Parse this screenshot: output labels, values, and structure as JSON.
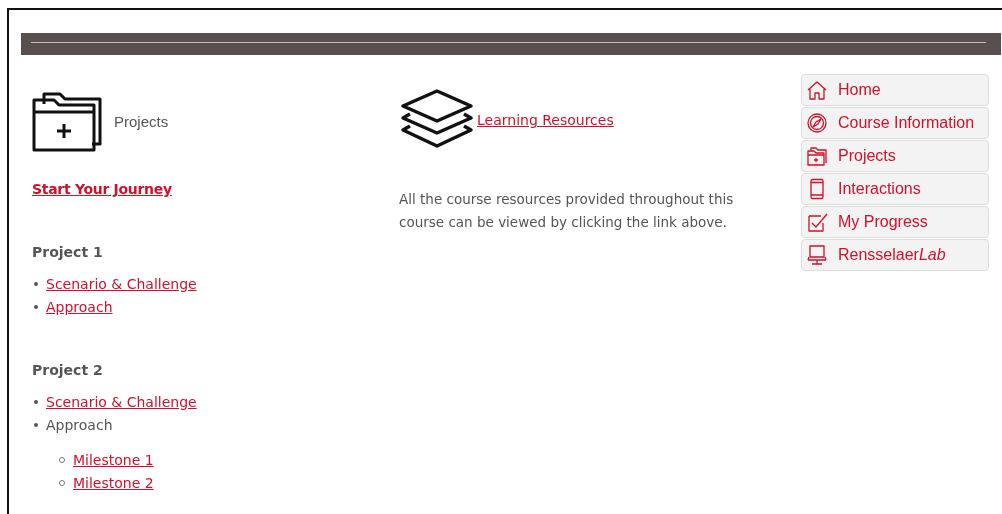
{
  "projects_card": {
    "title": "Projects"
  },
  "start_link": "Start Your Journey",
  "projects": [
    {
      "heading": "Project 1",
      "items": [
        {
          "label": "Scenario & Challenge",
          "kind": "link"
        },
        {
          "label": "Approach",
          "kind": "link"
        }
      ]
    },
    {
      "heading": "Project 2",
      "items": [
        {
          "label": "Scenario & Challenge",
          "kind": "link"
        },
        {
          "label": "Approach",
          "kind": "text",
          "children": [
            {
              "label": "Milestone 1",
              "kind": "link"
            },
            {
              "label": "Milestone 2",
              "kind": "link"
            }
          ]
        }
      ]
    }
  ],
  "resources": {
    "link": "Learning Resources",
    "description": "All the course resources provided throughout this course can be viewed by clicking the link above."
  },
  "nav": [
    {
      "label": "Home",
      "kind": "home"
    },
    {
      "label": "Course Information",
      "kind": "compass"
    },
    {
      "label": "Projects",
      "kind": "folder"
    },
    {
      "label": "Interactions",
      "kind": "phone"
    },
    {
      "label": "My Progress",
      "kind": "check"
    },
    {
      "label": "Rensselaer",
      "label_italic": "Lab",
      "kind": "computer"
    }
  ]
}
